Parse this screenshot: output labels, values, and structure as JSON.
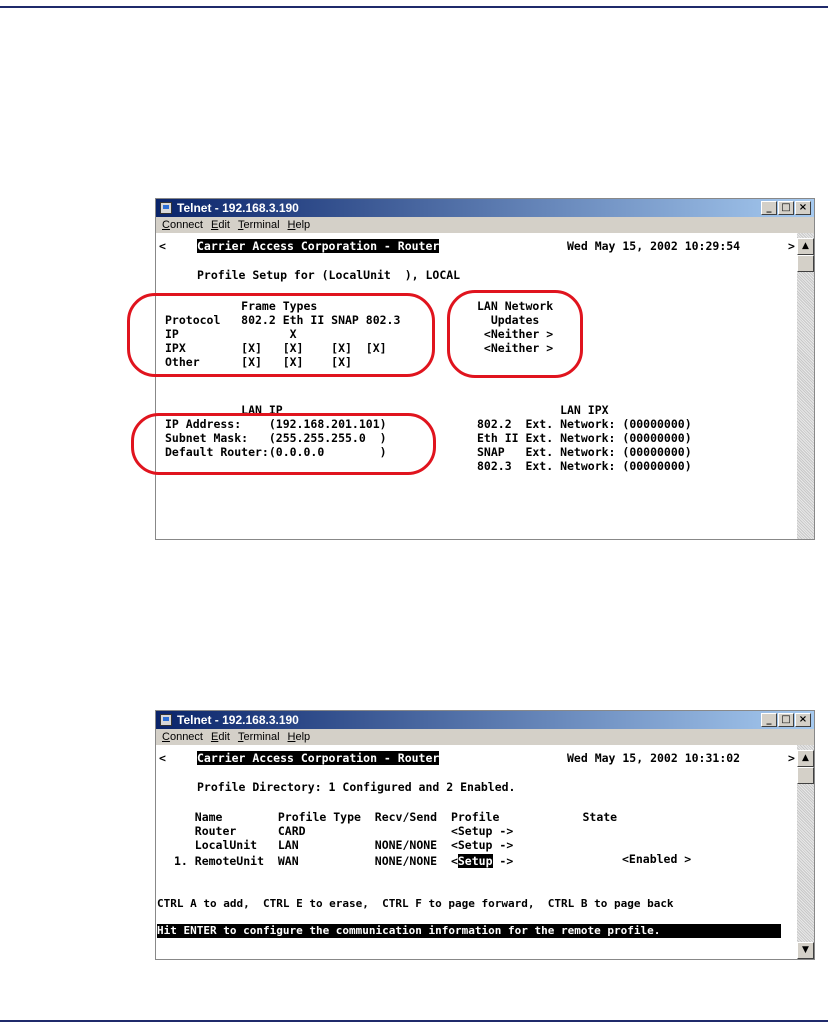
{
  "window1": {
    "title": "Telnet - 192.168.3.190",
    "menu": [
      "Connect",
      "Edit",
      "Terminal",
      "Help"
    ],
    "lines": [
      "<",
      "Carrier Access Corporation - Router",
      "Wed May 15, 2002 10:29:54",
      ">",
      "Profile Setup for (LocalUnit  ), LOCAL",
      "           Frame Types",
      "Protocol   802.2 Eth II SNAP 802.3",
      "IP                X",
      "IPX        [X]   [X]    [X]  [X]",
      "Other      [X]   [X]    [X]",
      "LAN Network",
      "  Updates",
      " <Neither >",
      " <Neither >",
      "           LAN IP",
      "IP Address:    (192.168.201.101)",
      "Subnet Mask:   (255.255.255.0  )",
      "Default Router:(0.0.0.0        )",
      "            LAN IPX",
      "802.2  Ext. Network: (00000000)",
      "Eth II Ext. Network: (00000000)",
      "SNAP   Ext. Network: (00000000)",
      "802.3  Ext. Network: (00000000)"
    ]
  },
  "window2": {
    "title": "Telnet - 192.168.3.190",
    "menu": [
      "Connect",
      "Edit",
      "Terminal",
      "Help"
    ],
    "lines": [
      "<",
      "Carrier Access Corporation - Router",
      "Wed May 15, 2002 10:31:02",
      ">",
      "Profile Directory: 1 Configured and 2 Enabled.",
      "   Name        Profile Type  Recv/Send  Profile            State",
      "   Router      CARD                     <Setup ->",
      "   LocalUnit   LAN           NONE/NONE  <Setup ->",
      "1. RemoteUnit  WAN           NONE/NONE  <",
      "Setup",
      " ->",
      "<Enabled >",
      "CTRL A to add,  CTRL E to erase,  CTRL F to page forward,  CTRL B to page back",
      "Hit ENTER to configure the communication information for the remote profile."
    ]
  },
  "icons": {
    "minimize": "_",
    "maximize": "□",
    "close": "×",
    "scroll_up": "▲",
    "scroll_down": "▼"
  },
  "colors": {
    "rule": "#1f2a6b",
    "annotation": "#e0141e",
    "titlebar": "#0a246a"
  }
}
